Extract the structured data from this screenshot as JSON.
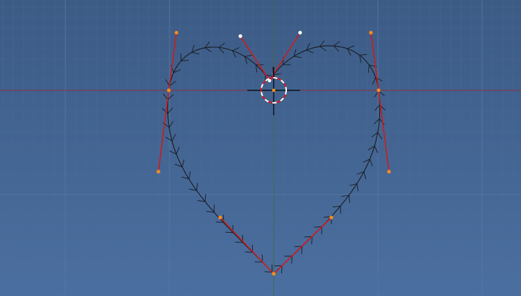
{
  "editor": {
    "view": "top-orthographic",
    "mode": "curve-edit"
  },
  "colors": {
    "background_top": "#3c5b85",
    "background_bottom": "#4b6fa0",
    "grid_minor": "#4e6f9a",
    "grid_major": "#5677a3",
    "axis_x": "#8e2f3a",
    "axis_y": "#3f6b4a",
    "curve": "#1b1f26",
    "handle_line": "#d11a1a",
    "point_selected": "#ff8c1a",
    "point_active": "#ffffff",
    "cursor_ring_dash": "#ffffff",
    "cursor_ring_alt": "#d11a1a",
    "cursor_cross": "#000000"
  },
  "curve": {
    "name": "heart-bezier",
    "cyclic": true,
    "control_points": [
      {
        "id": "top-center",
        "selected": true
      },
      {
        "id": "upper-left",
        "selected": true
      },
      {
        "id": "lower-left",
        "selected": true
      },
      {
        "id": "bottom-tip",
        "selected": true
      },
      {
        "id": "lower-right",
        "selected": true
      },
      {
        "id": "upper-right",
        "selected": true
      }
    ]
  },
  "cursor_3d": {
    "icon": "3d-cursor-icon"
  }
}
